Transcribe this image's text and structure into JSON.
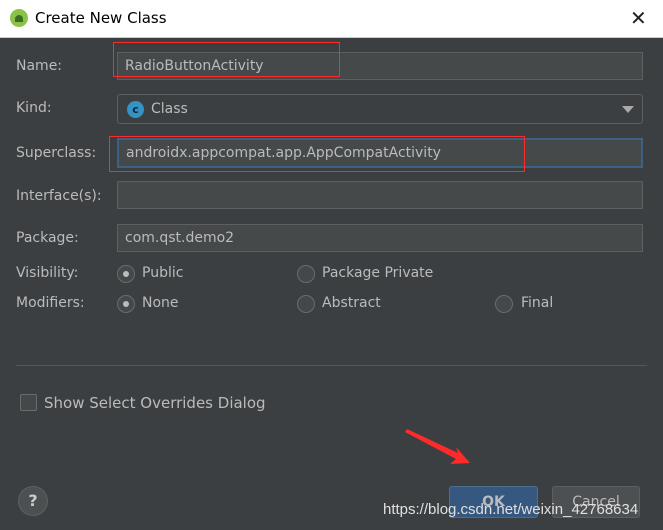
{
  "window": {
    "title": "Create New Class",
    "close_icon": "close-icon",
    "logo_icon": "android-studio-logo"
  },
  "form": {
    "name_label": "Name:",
    "name_value": "RadioButtonActivity",
    "kind_label": "Kind:",
    "kind_value": "Class",
    "kind_icon_letter": "c",
    "superclass_label": "Superclass:",
    "superclass_value": "androidx.appcompat.app.AppCompatActivity",
    "interfaces_label": "Interface(s):",
    "interfaces_value": "",
    "package_label": "Package:",
    "package_value": "com.qst.demo2",
    "visibility_label": "Visibility:",
    "visibility_options": [
      "Public",
      "Package Private"
    ],
    "visibility_selected": "Public",
    "modifiers_label": "Modifiers:",
    "modifiers_options": [
      "None",
      "Abstract",
      "Final"
    ],
    "modifiers_selected": "None",
    "overrides_label": "Show Select Overrides Dialog",
    "overrides_checked": false
  },
  "buttons": {
    "help": "?",
    "ok": "OK",
    "cancel": "Cancel"
  },
  "watermark": "https://blog.csdn.net/weixin_42768634",
  "colors": {
    "annotation": "#ff2a2a",
    "accent": "#365880"
  }
}
